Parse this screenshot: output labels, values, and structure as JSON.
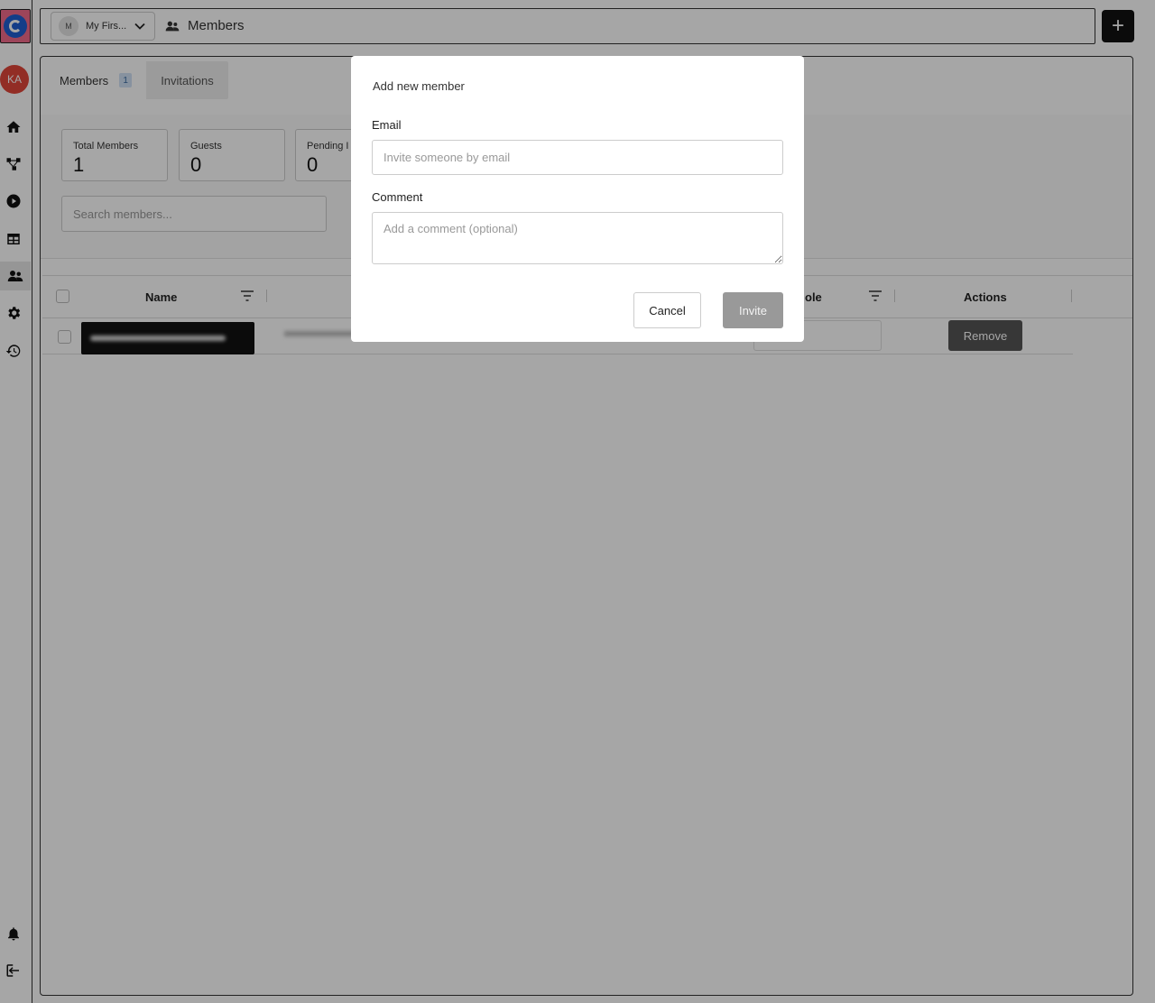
{
  "workspace": {
    "avatar_initial": "M",
    "name": "My Firs..."
  },
  "breadcrumb": {
    "title": "Members"
  },
  "user": {
    "initials": "KA"
  },
  "tabs": [
    {
      "label": "Members",
      "count": "1"
    },
    {
      "label": "Invitations"
    }
  ],
  "stats": [
    {
      "label": "Total Members",
      "value": "1"
    },
    {
      "label": "Guests",
      "value": "0"
    },
    {
      "label": "Pending I",
      "value": "0"
    }
  ],
  "search": {
    "placeholder": "Search members..."
  },
  "table": {
    "columns": [
      "Name",
      "ole",
      "Actions"
    ],
    "rows": [
      {
        "action_label": "Remove"
      }
    ]
  },
  "modal": {
    "title": "Add new member",
    "email_label": "Email",
    "email_placeholder": "Invite someone by email",
    "comment_label": "Comment",
    "comment_placeholder": "Add a comment (optional)",
    "cancel_label": "Cancel",
    "invite_label": "Invite"
  },
  "colors": {
    "overlay": "#000000",
    "avatar_bg": "#e0453a",
    "tab_badge_bg": "#cfe1f5",
    "invite_disabled": "#999999"
  }
}
